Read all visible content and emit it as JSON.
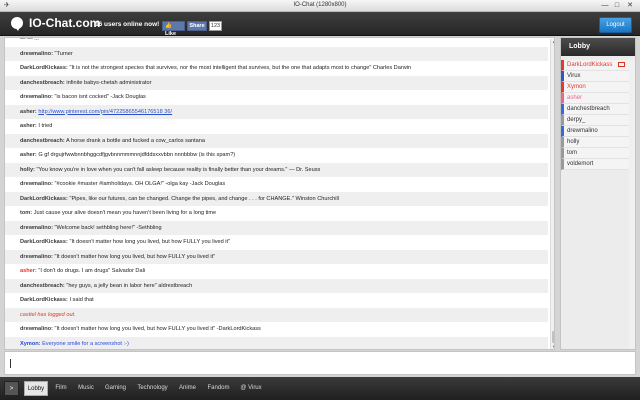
{
  "window": {
    "title": "IO-Chat (1280x800)",
    "controls": {
      "minimize": "—",
      "maximize": "□",
      "close": "✕"
    }
  },
  "header": {
    "logo_text": "IO-Chat.com",
    "online_text": "16 users online now!",
    "fb_like_label": "👍 Like",
    "fb_share_label": "Share",
    "fb_share_count": "123",
    "logout_label": "Logout"
  },
  "chat": {
    "messages": [
      {
        "user": "",
        "text": "— — ..."
      },
      {
        "user": "drewmalino:",
        "text": "\"Turner"
      },
      {
        "user": "DarkLordKickass:",
        "text": "\"It is not the strongest species that survives, nor the most intelligent that survives, but the one that adapts most to change\" Charles Darwin"
      },
      {
        "user": "danchestbreach:",
        "text": "infinite babys-chetah administrator"
      },
      {
        "user": "drewmalino:",
        "text": "\"is bacon isnt cocked\" -Jack Douglas"
      },
      {
        "user": "asher:",
        "text": "",
        "link": "http://www.pinterest.com/pin/47225865546176518 36/"
      },
      {
        "user": "asher:",
        "text": "I tried"
      },
      {
        "user": "danchestbreach:",
        "text": "A horse drank a bottle and fucked a cow_carlos santana"
      },
      {
        "user": "asher:",
        "text": "G gf drgujrfwwbnnbhggcdfjgvbnnmmmnnjdfddsxxvbbn nnnbbbw (is this spam?)"
      },
      {
        "user": "holly:",
        "text": "\"You know you're in love when you can't fall asleep because reality is finally better than your dreams.\" — Dr. Seuss"
      },
      {
        "user": "drewmalino:",
        "text": "\"#cookie #master #iamholidays. OH OLGA!\" -olga kay -Jack Douglas"
      },
      {
        "user": "DarkLordKickass:",
        "text": "\"Pipes, like our futures, can be changed. Change the pipes, and change . . . for CHANGE.\" Winston Churchill"
      },
      {
        "user": "tom:",
        "text": "Just cause your alive doesn't mean you haven't been living for a long time"
      },
      {
        "user": "drewmalino:",
        "text": "\"Welcome back! sethbling here!\" -Sethbling"
      },
      {
        "user": "DarkLordKickass:",
        "text": "\"It doesn't matter how long you lived, but how FULLY you lived it\""
      },
      {
        "user": "drewmalino:",
        "text": "\"It doesn't matter how long you lived, but how FULLY you lived it\""
      },
      {
        "user": "asher:",
        "text": "\"I don't do drugs. I am drugs\" Salvador Dali",
        "mention": true
      },
      {
        "user": "danchestbreach:",
        "text": "\"hey guys, a jelly bean in labor here\" aldrestbreach"
      },
      {
        "user": "DarkLordKickass:",
        "text": "I said that"
      },
      {
        "user": "",
        "text": "castiel has logged out.",
        "system": true
      },
      {
        "user": "drewmalino:",
        "text": "\"It doesn't matter how long you lived, but how FULLY you lived it\" -DarkLordKickass"
      },
      {
        "user": "Xymon:",
        "text": "Everyone smile for a screenshot :-)",
        "xymon": true
      }
    ]
  },
  "sidebar": {
    "room_title": "Lobby",
    "users": [
      {
        "name": "DarkLordKickass",
        "color": "#e23a30",
        "badge": true
      },
      {
        "name": "Virux",
        "color": "#2a58c9"
      },
      {
        "name": "Xymon",
        "color": "#e23a30"
      },
      {
        "name": "asher",
        "color": "#e8678a"
      },
      {
        "name": "danchestbreach",
        "color": "#3a6ad6"
      },
      {
        "name": "derpy_",
        "color": "#999999"
      },
      {
        "name": "drewmalino",
        "color": "#3a6ad6"
      },
      {
        "name": "holly",
        "color": "#999999"
      },
      {
        "name": "tom",
        "color": "#999999"
      },
      {
        "name": "voldemort",
        "color": "#999999"
      }
    ]
  },
  "tabs": {
    "arrow": ">",
    "items": [
      "Lobby",
      "Film",
      "Music",
      "Gaming",
      "Technology",
      "Anime",
      "Fandom",
      "@ Virux"
    ],
    "active_index": 0
  }
}
